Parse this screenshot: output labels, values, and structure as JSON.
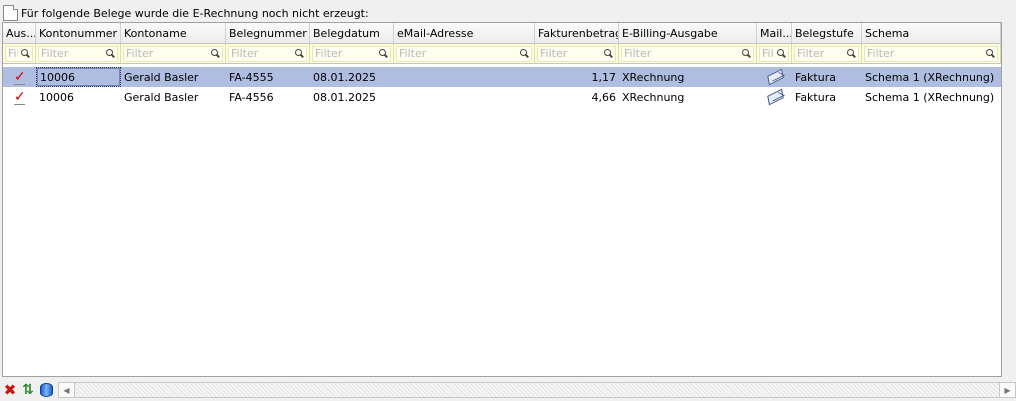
{
  "caption": "Für folgende Belege wurde die E-Rechnung noch nicht erzeugt:",
  "filter_placeholder": "Filter",
  "columns": [
    {
      "key": "aus",
      "label": "Aus..."
    },
    {
      "key": "kontonummer",
      "label": "Kontonummer"
    },
    {
      "key": "kontoname",
      "label": "Kontoname"
    },
    {
      "key": "belegnummer",
      "label": "Belegnummer"
    },
    {
      "key": "belegdatum",
      "label": "Belegdatum"
    },
    {
      "key": "email",
      "label": "eMail-Adresse"
    },
    {
      "key": "fakturenbetrag",
      "label": "Fakturenbetrag"
    },
    {
      "key": "ebilling",
      "label": "E-Billing-Ausgabe"
    },
    {
      "key": "mail",
      "label": "Mail..."
    },
    {
      "key": "belegstufe",
      "label": "Belegstufe"
    },
    {
      "key": "schema",
      "label": "Schema"
    }
  ],
  "rows": [
    {
      "selected": true,
      "checked": true,
      "kontonummer": "10006",
      "kontoname": "Gerald Basler",
      "belegnummer": "FA-4555",
      "belegdatum": "08.01.2025",
      "email": "",
      "fakturenbetrag": "1,17",
      "ebilling": "XRechnung",
      "mail_icon": "envelope-icon",
      "belegstufe": "Faktura",
      "schema": "Schema 1 (XRechnung)"
    },
    {
      "selected": false,
      "checked": true,
      "kontonummer": "10006",
      "kontoname": "Gerald Basler",
      "belegnummer": "FA-4556",
      "belegdatum": "08.01.2025",
      "email": "",
      "fakturenbetrag": "4,66",
      "ebilling": "XRechnung",
      "mail_icon": "envelope-icon",
      "belegstufe": "Faktura",
      "schema": "Schema 1 (XRechnung)"
    }
  ],
  "toolbar": {
    "delete_icon": "red-x-icon",
    "sort_icon": "up-down-arrows-icon",
    "export_icon": "database-icon"
  },
  "colors": {
    "selected_row": "#aebde0",
    "filter_row": "#fdfdd6",
    "check": "#d40000"
  }
}
